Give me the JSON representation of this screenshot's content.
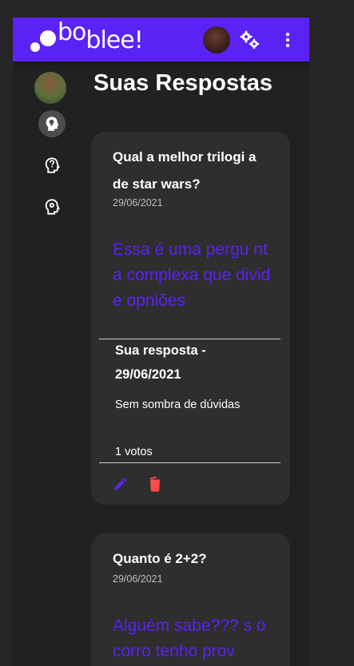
{
  "app": {
    "logo_text_a": "bo",
    "logo_text_b": "blee!"
  },
  "colors": {
    "brand": "#5b22f5",
    "danger": "#ff4d4d",
    "card": "#2e2e2e",
    "background": "#212121"
  },
  "topbar": {
    "icons": [
      "user-avatar",
      "gears-icon",
      "more-vert-icon"
    ]
  },
  "sidebar": {
    "items": [
      "user-avatar",
      "lightbulb-head-icon",
      "question-head-icon",
      "gear-head-icon"
    ]
  },
  "page": {
    "title": "Suas Respostas"
  },
  "cards": [
    {
      "question": "Qual a melhor trilogi a de star wars?",
      "date": "29/06/2021",
      "body": "Essa é uma pergu nta complexa que divide opniões",
      "answer": {
        "title": "Sua resposta - 29/06/2021",
        "text": "Sem sombra de dúvidas",
        "votes": "1 votos"
      },
      "actions": [
        "edit-icon",
        "delete-icon"
      ]
    },
    {
      "question": "Quanto é 2+2?",
      "date": "29/06/2021",
      "body": "Alguém sabe??? s ocorro tenho prov"
    }
  ]
}
